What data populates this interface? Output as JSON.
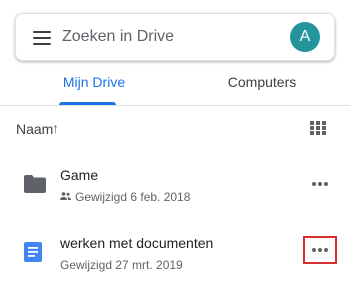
{
  "search": {
    "placeholder": "Zoeken in Drive",
    "avatar_letter": "A",
    "avatar_color": "#23959b"
  },
  "tabs": [
    {
      "label": "Mijn Drive",
      "active": true
    },
    {
      "label": "Computers",
      "active": false
    }
  ],
  "colors": {
    "accent": "#1a73e8",
    "highlight": "#d32f2f",
    "docs_blue": "#4285f4",
    "folder_gray": "#5f6368"
  },
  "sort": {
    "label": "Naam",
    "arrow": "↑",
    "view_icon": "grid-view-icon"
  },
  "files": [
    {
      "name": "Game",
      "meta": "Gewijzigd 6 feb. 2018",
      "type": "folder",
      "shared": true,
      "icon": "folder-icon"
    },
    {
      "name": "werken met documenten",
      "meta": "Gewijzigd 27 mrt. 2019",
      "type": "document",
      "shared": false,
      "icon": "google-docs-icon",
      "more_highlighted": true
    }
  ]
}
